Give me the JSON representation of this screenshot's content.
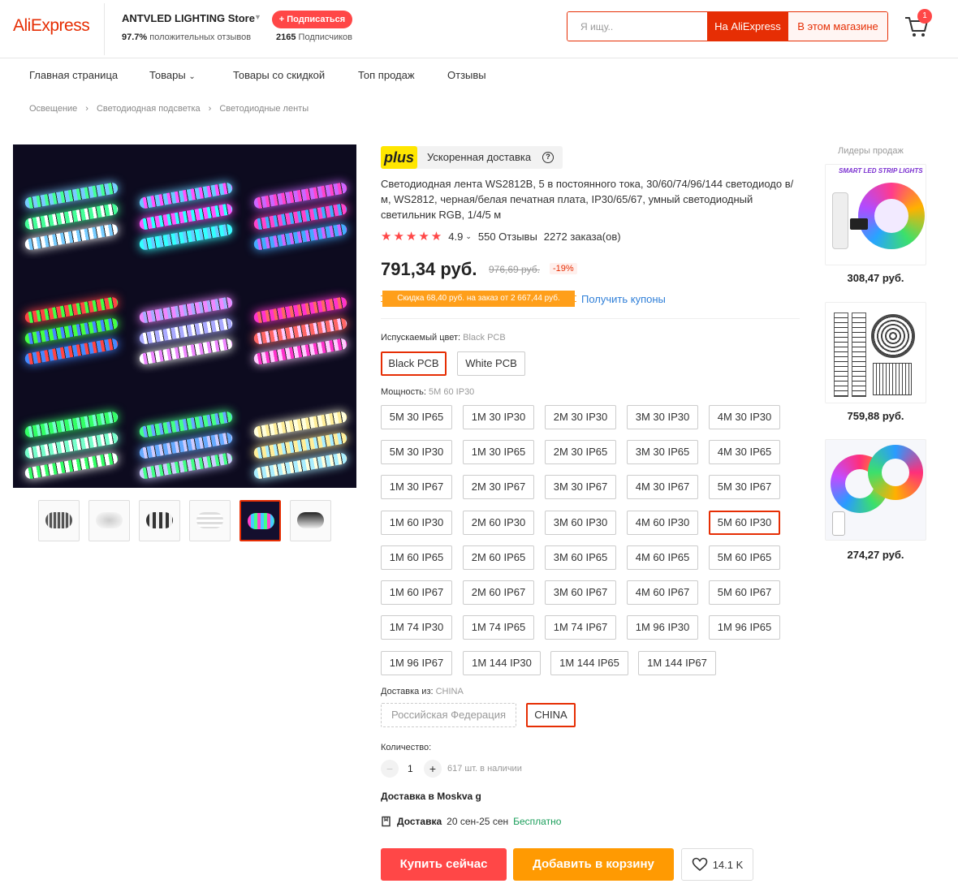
{
  "header": {
    "logo": "AliExpress",
    "store_name": "ANTVLED LIGHTING Store",
    "follow_label": "+ Подписаться",
    "positive_pct": "97.7%",
    "positive_label": "положительных отзывов",
    "followers_count": "2165",
    "followers_label": "Подписчиков",
    "search_placeholder": "Я ищу..",
    "search_ae_label": "На AliExpress",
    "search_store_label": "В этом магазине",
    "cart_count": "1"
  },
  "nav": {
    "items": [
      "Главная страница",
      "Товары",
      "Товары со скидкой",
      "Топ продаж",
      "Отзывы"
    ]
  },
  "breadcrumb": [
    "Освещение",
    "Светодиодная подсветка",
    "Светодиодные ленты"
  ],
  "product": {
    "plus_logo": "plus",
    "plus_text": "Ускоренная доставка",
    "title": "Светодиодная лента WS2812B, 5 в постоянного тока, 30/60/74/96/144 светодиодо в/м, WS2812, черная/белая печатная плата, IP30/65/67, умный светодиодный светильник RGB, 1/4/5 м",
    "rating": "4.9",
    "reviews": "550 Отзывы",
    "orders": "2272 заказа(ов)",
    "price": "791,34 руб.",
    "old_price": "976,69 руб.",
    "discount": "-19%",
    "coupon_text": "Скидка 68,40 руб. на заказ от 2 667,44 руб.",
    "coupon_link": "Получить купоны",
    "color_label": "Испускаемый цвет:",
    "color_value": "Black PCB",
    "colors": [
      "Black PCB",
      "White PCB"
    ],
    "power_label": "Мощность:",
    "power_value": "5M 60 IP30",
    "powers": [
      "5M 30 IP65",
      "1M 30 IP30",
      "2M 30 IP30",
      "3M 30 IP30",
      "4M 30 IP30",
      "5M 30 IP30",
      "1M 30 IP65",
      "2M 30 IP65",
      "3M 30 IP65",
      "4M 30 IP65",
      "1M 30 IP67",
      "2M 30 IP67",
      "3M 30 IP67",
      "4M 30 IP67",
      "5M 30 IP67",
      "1M 60 IP30",
      "2M 60 IP30",
      "3M 60 IP30",
      "4M 60 IP30",
      "5M 60 IP30",
      "1M 60 IP65",
      "2M 60 IP65",
      "3M 60 IP65",
      "4M 60 IP65",
      "5M 60 IP65",
      "1M 60 IP67",
      "2M 60 IP67",
      "3M 60 IP67",
      "4M 60 IP67",
      "5M 60 IP67",
      "1M 74 IP30",
      "1M 74 IP65",
      "1M 74 IP67",
      "1M 96 IP30",
      "1M 96 IP65",
      "1M 96 IP67",
      "1M 144 IP30",
      "1M 144 IP65",
      "1M 144 IP67"
    ],
    "ship_from_label": "Доставка из:",
    "ship_from_value": "CHINA",
    "ship_from_options": [
      "Российская Федерация",
      "CHINA"
    ],
    "qty_label": "Количество:",
    "qty_value": "1",
    "qty_minus": "−",
    "qty_plus": "+",
    "stock": "617 шт. в наличии",
    "ship_to": "Доставка в Moskva g",
    "delivery_label": "Доставка",
    "delivery_dates": "20 сен-25 сен",
    "delivery_cost": "Бесплатно",
    "buy_now": "Купить сейчас",
    "add_to_cart": "Добавить в корзину",
    "wishlist_count": "14.1 K"
  },
  "rail": {
    "title": "Лидеры продаж",
    "item1_banner": "SMART LED STRIP LIGHTS",
    "prices": [
      "308,47 руб.",
      "759,88 руб.",
      "274,27 руб."
    ]
  },
  "colors": {
    "brand": "#e62e04",
    "accent_red": "#ff4747",
    "accent_orange": "#ff9a02",
    "plus_yellow": "#ffe600",
    "link_blue": "#2f7fd8",
    "free_green": "#1a9e5a"
  }
}
